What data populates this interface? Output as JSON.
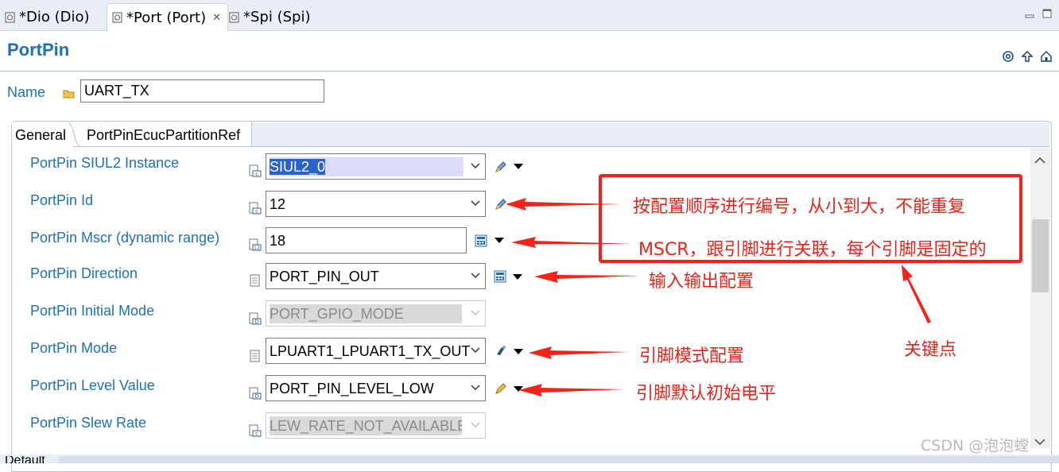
{
  "editor_tabs": [
    {
      "label": "*Dio (Dio)"
    },
    {
      "label": "*Port (Port)"
    },
    {
      "label": "*Spi (Spi)"
    }
  ],
  "page": {
    "title": "PortPin",
    "name_label": "Name",
    "name_value": "UART_TX"
  },
  "panel_tabs": {
    "general": "General",
    "partition_ref": "PortPinEcucPartitionRef"
  },
  "rows": {
    "siul2_instance": {
      "label": "PortPin SIUL2 Instance",
      "value": "SIUL2_0"
    },
    "pin_id": {
      "label": "PortPin Id",
      "value": "12"
    },
    "mscr": {
      "label": "PortPin Mscr (dynamic range)",
      "value": "18"
    },
    "direction": {
      "label": "PortPin Direction",
      "value": "PORT_PIN_OUT"
    },
    "initial_mode": {
      "label": "PortPin Initial Mode",
      "value": "PORT_GPIO_MODE"
    },
    "mode": {
      "label": "PortPin Mode",
      "value": "LPUART1_LPUART1_TX_OUT"
    },
    "level_value": {
      "label": "PortPin Level Value",
      "value": "PORT_PIN_LEVEL_LOW"
    },
    "slew_rate": {
      "label": "PortPin Slew Rate",
      "value": "LEW_RATE_NOT_AVAILABLE"
    }
  },
  "annotations": {
    "id_note": "按配置顺序进行编号，从小到大，不能重复",
    "mscr_note": "MSCR，跟引脚进行关联，每个引脚是固定的",
    "direction_note": "输入输出配置",
    "key_point": "关键点",
    "mode_note": "引脚模式配置",
    "level_note": "引脚默认初始电平"
  },
  "bottom_tab": "Default",
  "watermark": "CSDN @泡泡螳",
  "colors": {
    "label_blue": "#1e6fb6",
    "annotation_red": "#e8231a",
    "selection_blue": "#2a63c5"
  },
  "icons": [
    "editor-tab-icon",
    "open-folder-icon",
    "config-class-icon",
    "calculator-icon",
    "edit-pencil-icon",
    "link-icon",
    "chevron-down-icon",
    "maximize-icon",
    "minimize-icon",
    "home-icon",
    "up-arrow-icon"
  ]
}
